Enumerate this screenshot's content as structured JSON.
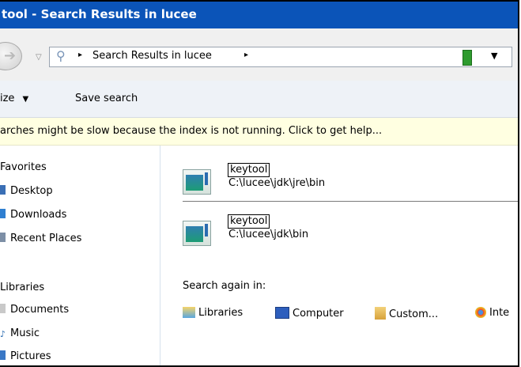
{
  "window": {
    "title": "tool - Search Results in lucee"
  },
  "address_bar": {
    "path_segment": "Search Results in lucee",
    "arrow": "▸",
    "dropdown": "▼"
  },
  "toolbar": {
    "organize_label": "ize",
    "organize_arrow": "▼",
    "save_search_label": "Save search"
  },
  "info_bar": {
    "message": "arches might be slow because the index is not running. Click to get help..."
  },
  "nav_pane": {
    "favorites_header": "Favorites",
    "favorites": [
      "Desktop",
      "Downloads",
      "Recent Places"
    ],
    "libraries_header": "Libraries",
    "libraries": [
      "Documents",
      "Music",
      "Pictures"
    ]
  },
  "results": [
    {
      "name": "keytool",
      "path": "C:\\lucee\\jdk\\jre\\bin"
    },
    {
      "name": "keytool",
      "path": "C:\\lucee\\jdk\\bin"
    }
  ],
  "search_again": {
    "label": "Search again in:",
    "items": [
      "Libraries",
      "Computer",
      "Custom...",
      "Inte"
    ]
  },
  "colors": {
    "titlebar": "#0b54b8",
    "infobar": "#ffffe1",
    "toolbar": "#eef2f7"
  }
}
